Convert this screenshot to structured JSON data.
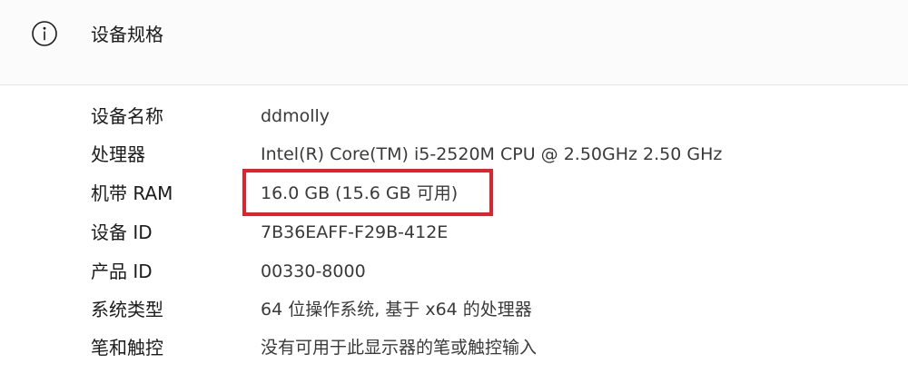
{
  "header": {
    "icon": "info-circle-icon",
    "title": "设备规格"
  },
  "specs": [
    {
      "label": "设备名称",
      "value": "ddmolly"
    },
    {
      "label": "处理器",
      "value": "Intel(R) Core(TM) i5-2520M CPU @ 2.50GHz   2.50 GHz"
    },
    {
      "label": "机带 RAM",
      "value": "16.0 GB (15.6 GB 可用)"
    },
    {
      "label": "设备 ID",
      "value": "7B36EAFF-F29B-412E"
    },
    {
      "label": "产品 ID",
      "value": "00330-8000"
    },
    {
      "label": "系统类型",
      "value": "64 位操作系统, 基于 x64 的处理器"
    },
    {
      "label": "笔和触控",
      "value": "没有可用于此显示器的笔或触控输入"
    }
  ],
  "colors": {
    "highlight_border": "#e0222c",
    "panel_background": "#fbfbfb"
  }
}
